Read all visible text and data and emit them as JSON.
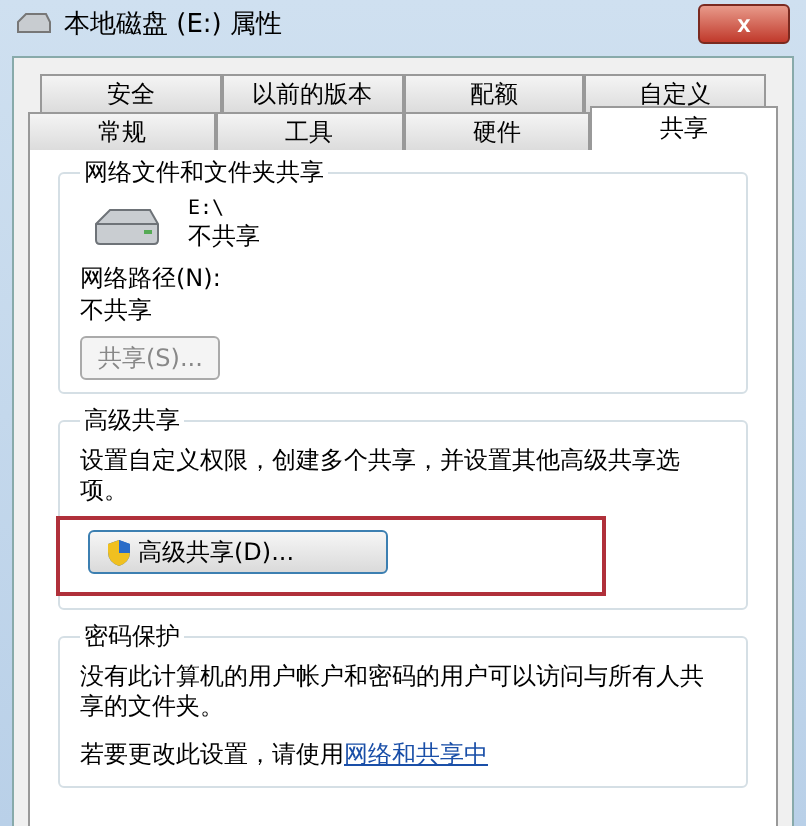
{
  "window": {
    "title": "本地磁盘 (E:) 属性",
    "close": "x"
  },
  "tabs": [
    [
      {
        "label": "安全",
        "selected": false
      },
      {
        "label": "以前的版本",
        "selected": false
      },
      {
        "label": "配额",
        "selected": false
      },
      {
        "label": "自定义",
        "selected": false
      }
    ],
    [
      {
        "label": "常规",
        "selected": false
      },
      {
        "label": "工具",
        "selected": false
      },
      {
        "label": "硬件",
        "selected": false
      },
      {
        "label": "共享",
        "selected": true
      }
    ]
  ],
  "network_sharing": {
    "title": "网络文件和文件夹共享",
    "drive": "E:\\",
    "status": "不共享",
    "path_label": "网络路径(N):",
    "path_value": "不共享",
    "button": {
      "label": "共享(S)...",
      "disabled": true
    }
  },
  "advanced_sharing": {
    "title": "高级共享",
    "description": "设置自定义权限，创建多个共享，并设置其他高级共享选项。",
    "button": {
      "label": "高级共享(D)...",
      "highlighted": true
    }
  },
  "password_protection": {
    "title": "密码保护",
    "description": "没有此计算机的用户帐户和密码的用户可以访问与所有人共享的文件夹。",
    "change_prefix": "若要更改此设置，请使用",
    "link": "网络和共享中"
  }
}
